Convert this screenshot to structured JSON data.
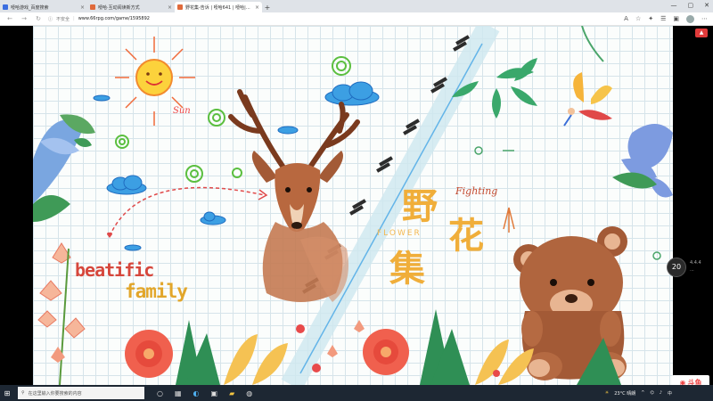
{
  "tabs": [
    {
      "label": "噎哈游戏_百度搜索",
      "color": "#3b6ee0",
      "active": false
    },
    {
      "label": "噎哈·互动阅读新方式",
      "color": "#e06a3b",
      "active": false
    },
    {
      "label": "野花集-告诉 | 噎哈641 | 噎哈|噎哈641",
      "color": "#e06a3b",
      "active": true
    }
  ],
  "window": {
    "minimize": "—",
    "maximize": "▢",
    "close": "✕"
  },
  "toolbar": {
    "secure_label": "不安全",
    "url": "www.66rpg.com/game/1595892"
  },
  "art": {
    "sun_label": "Sun",
    "beatific": "beatific",
    "family": "family",
    "fighting": "Fighting",
    "flower_en": "FLOWER",
    "title_1": "野",
    "title_2": "花",
    "title_3": "集"
  },
  "overlay": {
    "timer": "20",
    "timer_sub1": "4.4.4",
    "timer_sub2": "...",
    "watermark": "斗鱼"
  },
  "taskbar": {
    "search_placeholder": "在这里输入你要搜索的内容",
    "weather": "23°C 晴朗",
    "time": "",
    "date": ""
  },
  "colors": {
    "accent": "#e03a3a",
    "title_gold": "#f0ae3a",
    "grid": "#d6e4ea"
  }
}
